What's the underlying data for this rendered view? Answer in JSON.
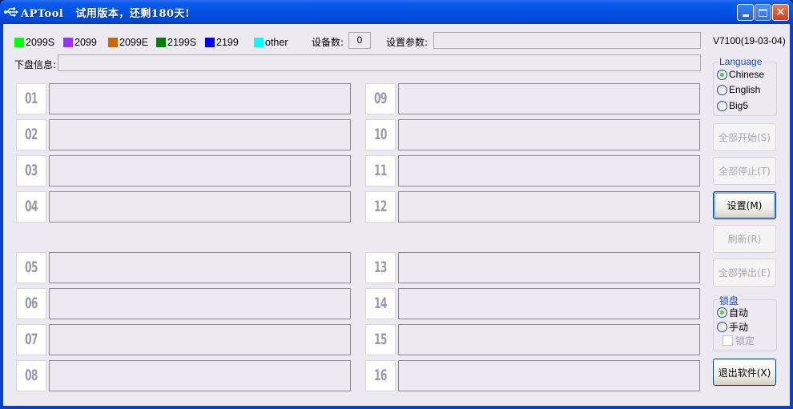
{
  "window": {
    "app_name": "APTool",
    "trial_text": "试用版本，还剩180天!",
    "controls": {
      "minimize": "minimize-icon",
      "maximize": "maximize-icon",
      "close": "close-icon"
    }
  },
  "legend": [
    {
      "label": "2099S",
      "color": "#00ff00"
    },
    {
      "label": "2099",
      "color": "#9b30ff"
    },
    {
      "label": "2099E",
      "color": "#cc6600"
    },
    {
      "label": "2199S",
      "color": "#008000"
    },
    {
      "label": "2199",
      "color": "#0000ff"
    },
    {
      "label": "other",
      "color": "#00ffff"
    }
  ],
  "device_count": {
    "label": "设备数:",
    "value": "0"
  },
  "settings_params": {
    "label": "设置参数:",
    "value": ""
  },
  "download_info": {
    "label": "下盘信息:",
    "value": ""
  },
  "version": "V7100(19-03-04)",
  "language": {
    "title": "Language",
    "options": [
      {
        "label": "Chinese",
        "checked": true
      },
      {
        "label": "English",
        "checked": false
      },
      {
        "label": "Big5",
        "checked": false
      }
    ]
  },
  "buttons": {
    "start_all": "全部开始(S)",
    "stop_all": "全部停止(T)",
    "settings": "设置(M)",
    "refresh": "刷新(R)",
    "eject_all": "全部弹出(E)",
    "exit": "退出软件(X)"
  },
  "lock": {
    "title": "锁盘",
    "options": [
      {
        "label": "自动",
        "checked": true
      },
      {
        "label": "手动",
        "checked": false
      }
    ],
    "lock_checkbox": {
      "label": "锁定",
      "checked": false,
      "enabled": false
    }
  },
  "slots": [
    {
      "number": "01",
      "status": ""
    },
    {
      "number": "02",
      "status": ""
    },
    {
      "number": "03",
      "status": ""
    },
    {
      "number": "04",
      "status": ""
    },
    {
      "number": "05",
      "status": ""
    },
    {
      "number": "06",
      "status": ""
    },
    {
      "number": "07",
      "status": ""
    },
    {
      "number": "08",
      "status": ""
    },
    {
      "number": "09",
      "status": ""
    },
    {
      "number": "10",
      "status": ""
    },
    {
      "number": "11",
      "status": ""
    },
    {
      "number": "12",
      "status": ""
    },
    {
      "number": "13",
      "status": ""
    },
    {
      "number": "14",
      "status": ""
    },
    {
      "number": "15",
      "status": ""
    },
    {
      "number": "16",
      "status": ""
    }
  ]
}
